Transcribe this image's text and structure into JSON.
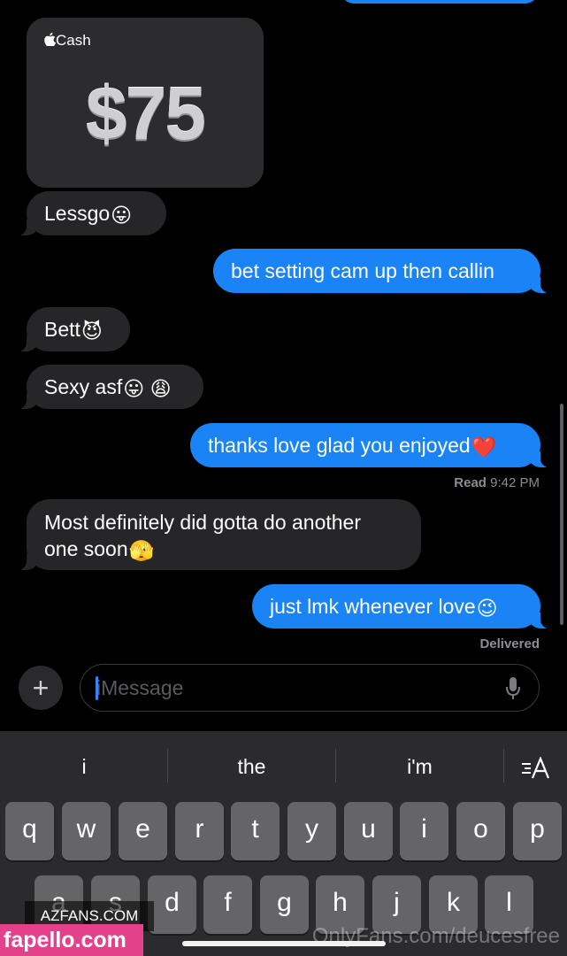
{
  "cash_card": {
    "brand": "Cash",
    "amount": "$75"
  },
  "messages": [
    {
      "text": "Lessgo",
      "emoji": "😛"
    },
    {
      "text": "bet setting cam up then callin"
    },
    {
      "text": "Bett",
      "emoji": "😈"
    },
    {
      "text": "Sexy asf",
      "emoji": "😛 😩"
    },
    {
      "text": "thanks love glad you enjoyed",
      "emoji": "❤️"
    },
    {
      "text_line1": "Most definitely did gotta do another",
      "text_line2": "one soon",
      "emoji": "🫣"
    },
    {
      "text": "just lmk whenever love",
      "emoji": "😉"
    }
  ],
  "status": {
    "read_label": "Read",
    "read_time": "9:42 PM",
    "delivered": "Delivered"
  },
  "input": {
    "placeholder": "iMessage"
  },
  "keyboard": {
    "suggestions": [
      "i",
      "the",
      "i'm"
    ],
    "row1": [
      "q",
      "w",
      "e",
      "r",
      "t",
      "y",
      "u",
      "i",
      "o",
      "p"
    ],
    "row2": [
      "a",
      "s",
      "d",
      "f",
      "g",
      "h",
      "j",
      "k",
      "l"
    ]
  },
  "watermarks": {
    "azfans": "AZFANS.COM",
    "fapello": "fapello.com",
    "onlyfans": "OnlyFans.com/deucesfree"
  },
  "colors": {
    "outgoing": "#1a84f7",
    "incoming": "#262628",
    "keyboard": "#2b2b2d",
    "key": "#656568"
  },
  "icons": [
    "apple-icon",
    "plus-icon",
    "mic-icon",
    "text-format-icon"
  ]
}
